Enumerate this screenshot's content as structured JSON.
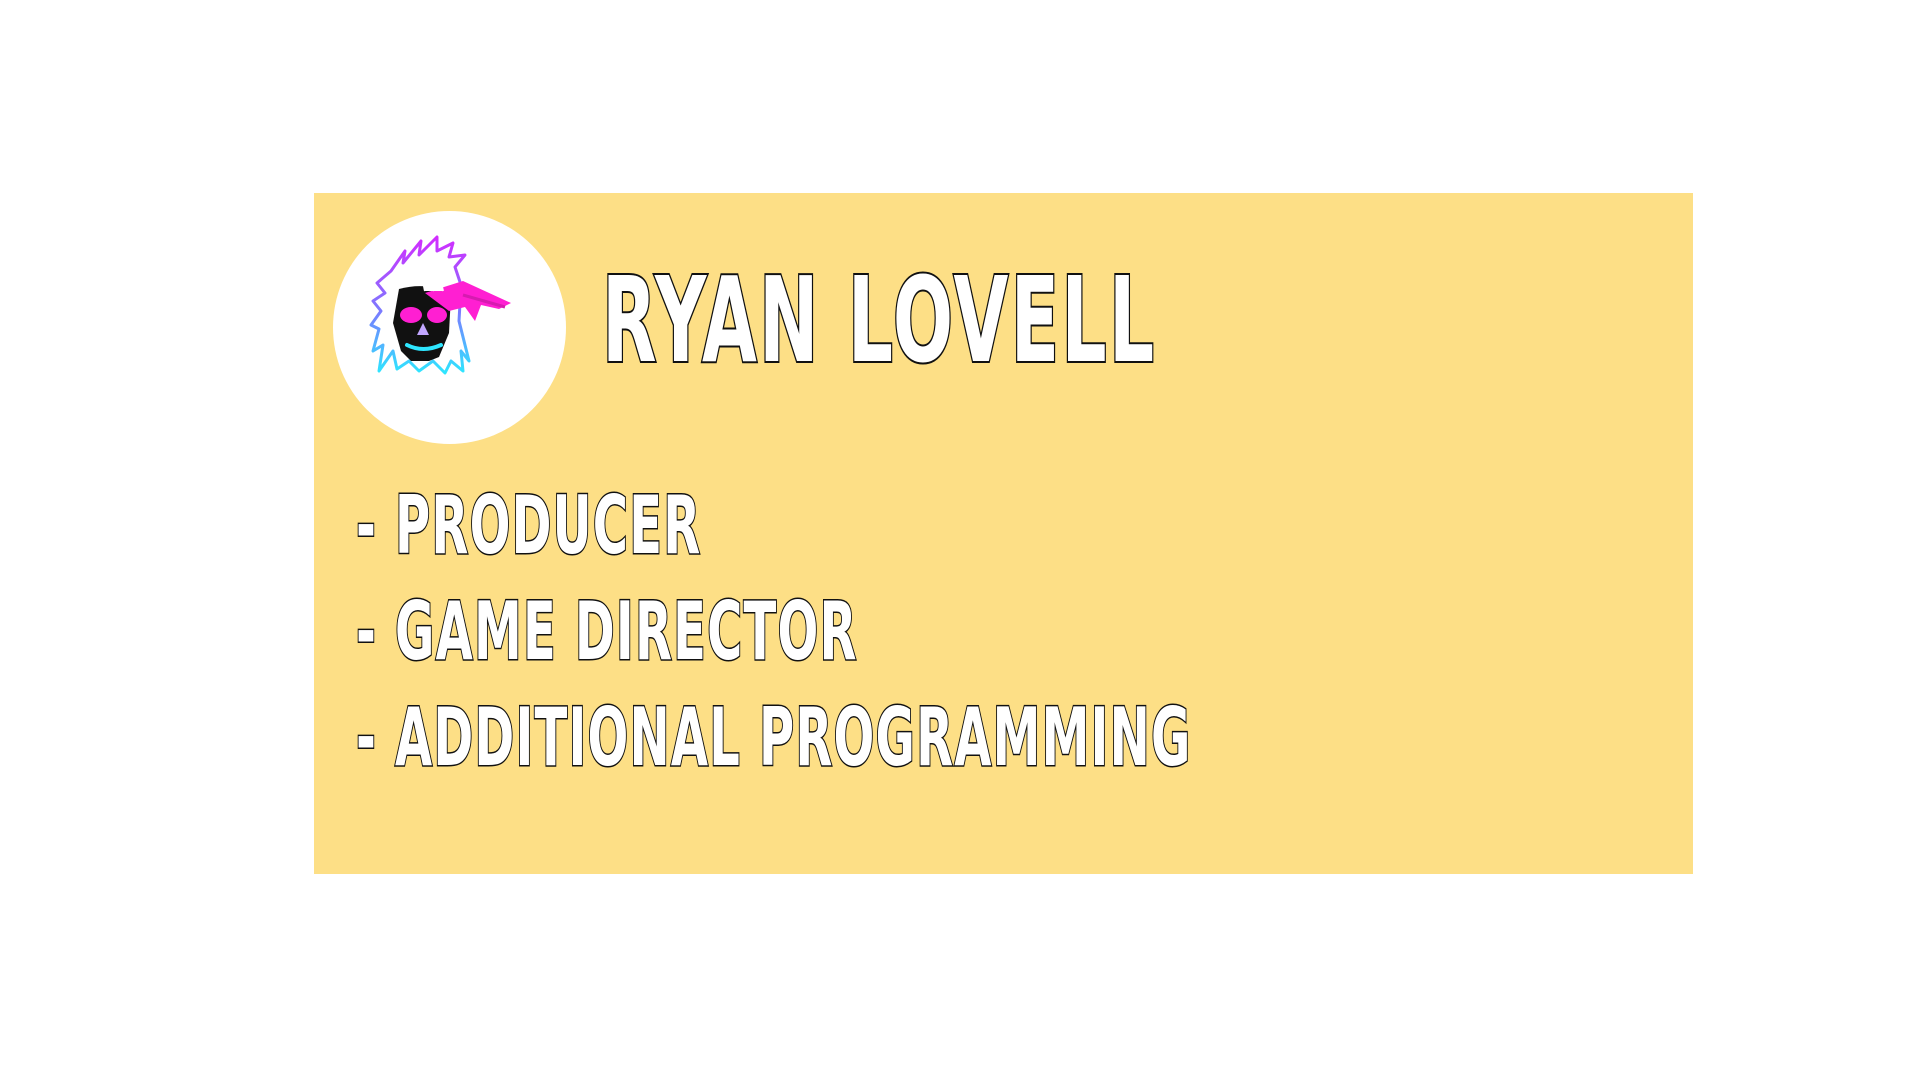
{
  "card": {
    "background": "#fddf86",
    "avatar_icon": "neon-skull-with-bandana",
    "name": "RYAN LOVELL",
    "roles": [
      "- PRODUCER",
      "- GAME DIRECTOR",
      "- ADDITIONAL PROGRAMMING"
    ]
  },
  "colors": {
    "page_background": "#ffffff",
    "text_fill": "#ffffff",
    "text_outline": "#111111",
    "accent_magenta": "#ff1fd2",
    "accent_cyan": "#2ee6ff"
  }
}
